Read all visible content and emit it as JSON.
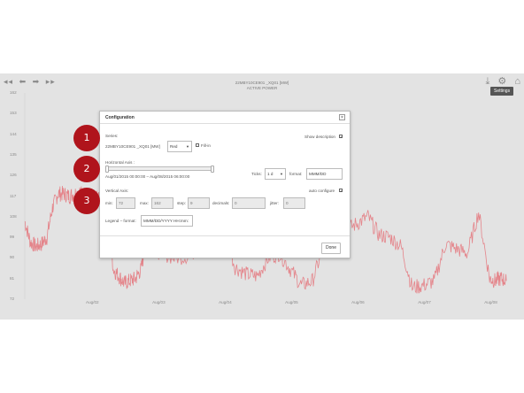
{
  "chart": {
    "title_line1": "22MBY10CE901 _XQ01 [MW]",
    "title_line2": "ACTIVE POWER",
    "settings_tooltip": "Settings",
    "nav_icons": [
      "back-icon",
      "left-arrow-icon",
      "right-arrow-icon",
      "forward-icon"
    ],
    "tool_icons": [
      "download-icon",
      "gear-icon",
      "home-icon"
    ],
    "line_color": "#e4848a",
    "y_ticks": [
      "162",
      "153",
      "144",
      "135",
      "126",
      "117",
      "108",
      "99",
      "90",
      "81",
      "72"
    ],
    "x_ticks": [
      "Aug/02",
      "Aug/03",
      "Aug/04",
      "Aug/05",
      "Aug/06",
      "Aug/07",
      "Aug/08"
    ]
  },
  "chart_data": {
    "type": "line",
    "title": "22MBY10CE901 _XQ01 [MW]",
    "subtitle": "ACTIVE POWER",
    "x_label": "",
    "y_label": "",
    "ylim": [
      72,
      162
    ],
    "xlim": [
      "2015-08-01 00:00",
      "2015-08-08 06:00"
    ],
    "series": [
      {
        "name": "22MBY10CE901 _XQ01 [MW]",
        "x": [
          "2015-08-01 00:00",
          "2015-08-01 02:00",
          "2015-08-01 04:00",
          "2015-08-01 06:00",
          "2015-08-01 08:00",
          "2015-08-01 10:00",
          "2015-08-01 12:00",
          "2015-08-01 14:00",
          "2015-08-01 16:00",
          "2015-08-01 18:00",
          "2015-08-01 20:00",
          "2015-08-01 22:00",
          "2015-08-02 00:00",
          "2015-08-02 02:00",
          "2015-08-02 04:00",
          "2015-08-02 06:00",
          "2015-08-02 08:00",
          "2015-08-02 10:00",
          "2015-08-02 12:00",
          "2015-08-02 14:00",
          "2015-08-02 16:00",
          "2015-08-02 18:00",
          "2015-08-02 20:00",
          "2015-08-02 22:00",
          "2015-08-03 00:00",
          "2015-08-03 06:00",
          "2015-08-03 12:00",
          "2015-08-03 18:00",
          "2015-08-04 00:00",
          "2015-08-04 04:00",
          "2015-08-04 08:00",
          "2015-08-04 12:00",
          "2015-08-04 16:00",
          "2015-08-04 20:00",
          "2015-08-05 00:00",
          "2015-08-05 04:00",
          "2015-08-05 08:00",
          "2015-08-05 12:00",
          "2015-08-05 16:00",
          "2015-08-05 20:00",
          "2015-08-06 00:00",
          "2015-08-06 04:00",
          "2015-08-06 08:00",
          "2015-08-06 12:00",
          "2015-08-06 16:00",
          "2015-08-06 20:00",
          "2015-08-07 00:00",
          "2015-08-07 04:00",
          "2015-08-07 08:00",
          "2015-08-07 12:00",
          "2015-08-07 16:00",
          "2015-08-07 20:00",
          "2015-08-08 00:00",
          "2015-08-08 02:00",
          "2015-08-08 04:00",
          "2015-08-08 06:00"
        ],
        "y": [
          106,
          97,
          95,
          96,
          99,
          112,
          118,
          118,
          117,
          118,
          119,
          115,
          110,
          116,
          118,
          109,
          85,
          82,
          79,
          80,
          81,
          85,
          97,
          100,
          93,
          90,
          91,
          100,
          102,
          86,
          83,
          82,
          90,
          92,
          85,
          78,
          80,
          95,
          100,
          102,
          105,
          108,
          100,
          99,
          95,
          77,
          78,
          80,
          96,
          94,
          92,
          110,
          81,
          80,
          81,
          80
        ]
      }
    ],
    "grid": false,
    "legend": "none"
  },
  "dialog": {
    "title": "Configuration",
    "close_label": "×",
    "series_label": "Series:",
    "series_name": "22MBY10CE901 _XQ01 [MW]",
    "color_value": "Red",
    "fill_in_label": "Fill-in",
    "show_description_label": "Show description",
    "show_description_checked": "✓",
    "horizontal_axis_label": "Horizontal Axis :",
    "range_text": "Aug/01/2015 00:00:00 – Aug/08/2015 06:00:00",
    "ticks_label": "Ticks:",
    "ticks_value": "1 d",
    "format_label": "format:",
    "format_value": "MMM/DD",
    "vertical_axis_label": "Vertical Axis:",
    "auto_configure_label": "auto configure",
    "auto_configure_checked": "✓",
    "min_label": "min:",
    "min_value": "72",
    "max_label": "max:",
    "max_value": "162",
    "step_label": "step:",
    "step_value": "9",
    "decimals_label": "decimals:",
    "decimals_value": "0",
    "jitter_label": "jitter:",
    "jitter_value": "0",
    "legend_format_label": "Legend – format:",
    "legend_format_value": "MMM/DD/YYYY HH:mm:",
    "done_label": "Done"
  },
  "markers": [
    "1",
    "2",
    "3"
  ],
  "marker_color": "#b0141c"
}
